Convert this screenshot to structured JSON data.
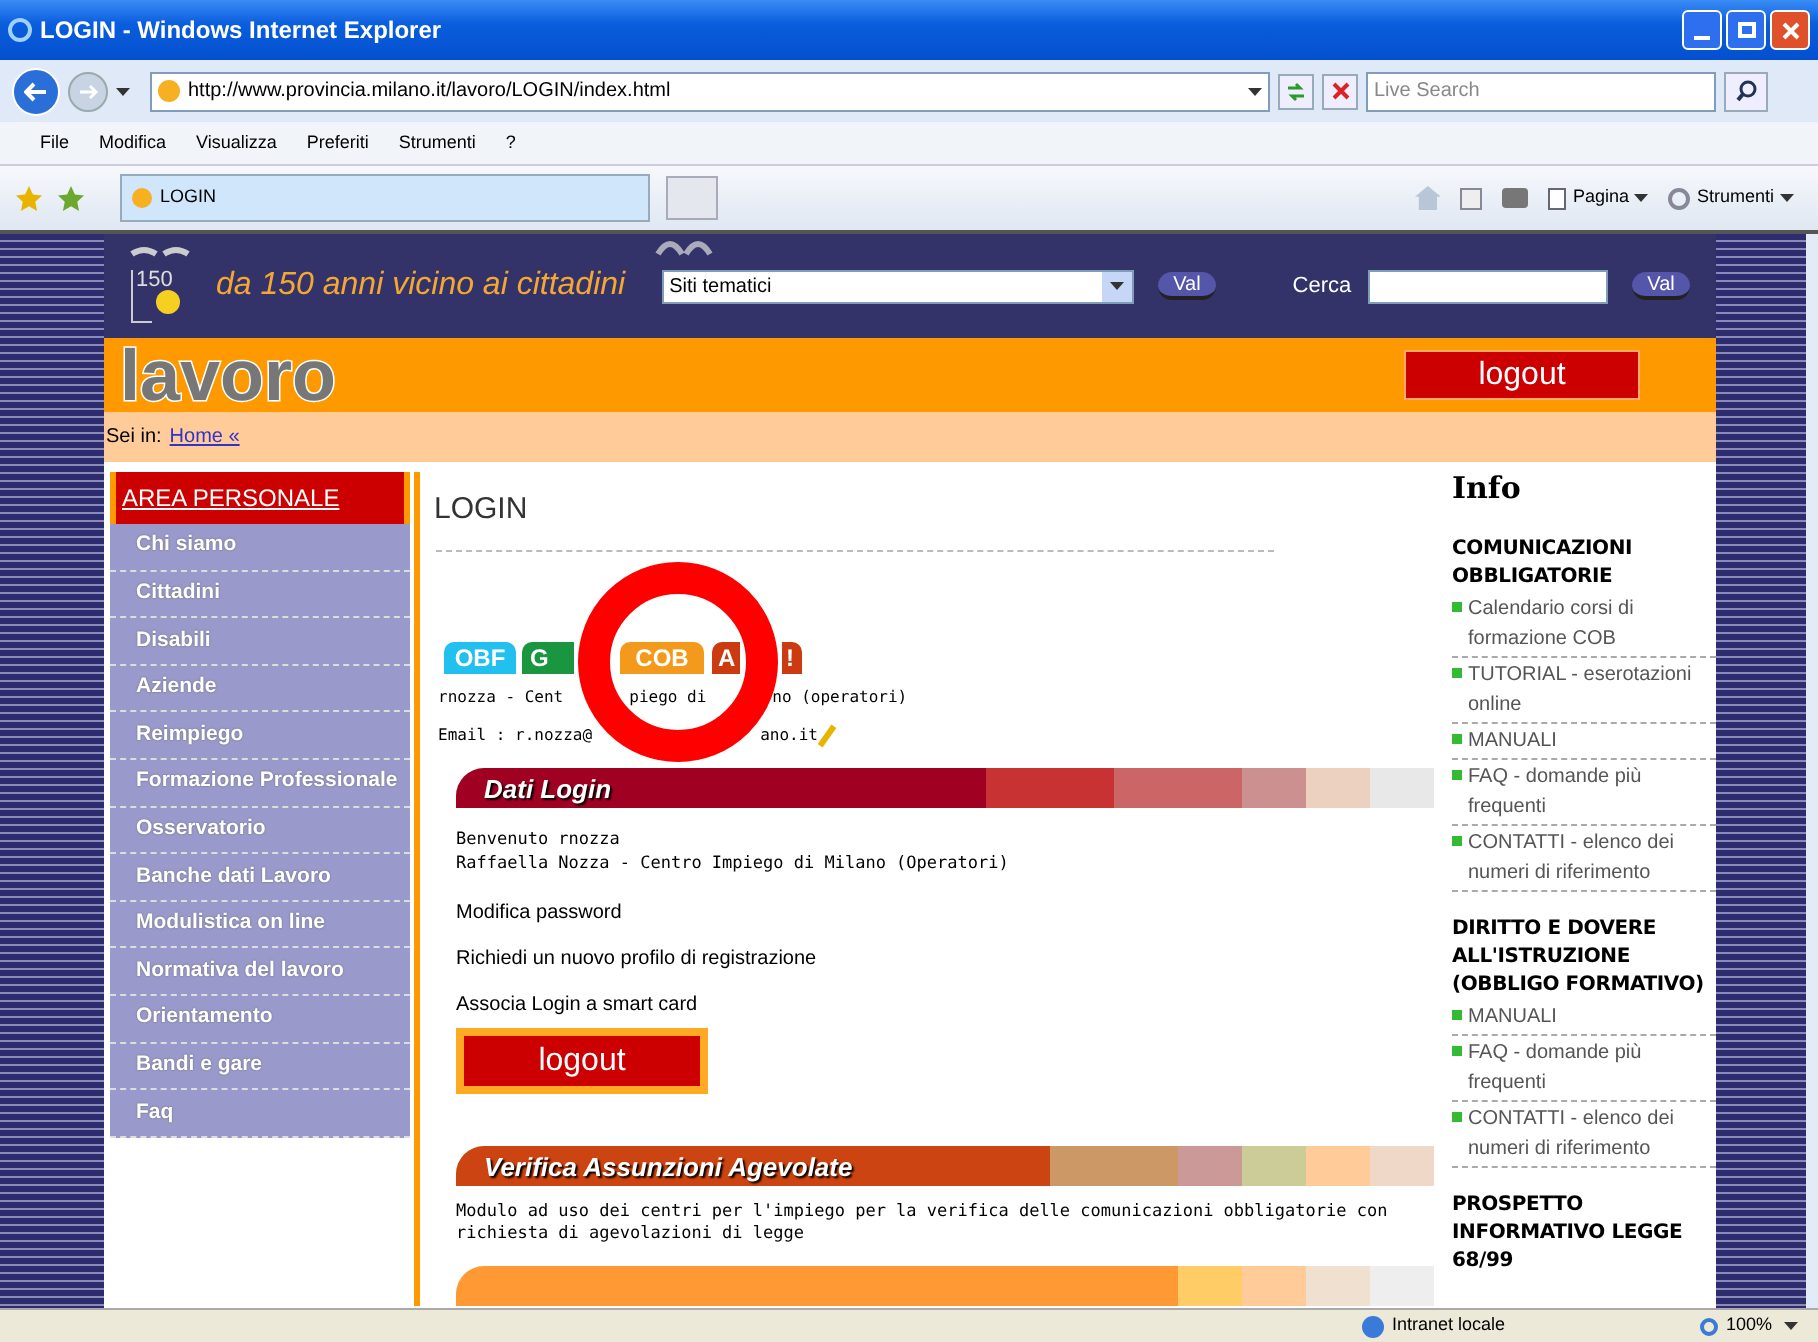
{
  "window": {
    "title": "LOGIN - Windows Internet Explorer"
  },
  "address_bar": {
    "url": "http://www.provincia.milano.it/lavoro/LOGIN/index.html",
    "search_placeholder": "Live Search"
  },
  "menu": [
    "File",
    "Modifica",
    "Visualizza",
    "Preferiti",
    "Strumenti",
    "?"
  ],
  "tabs": [
    {
      "label": "LOGIN",
      "selected": true
    }
  ],
  "command_bar": [
    "Pagina",
    "Strumenti"
  ],
  "page": {
    "header": {
      "logo_text": "150",
      "slogan": "da 150 anni vicino ai cittadini",
      "select_value": "Siti tematici",
      "go_buttons": [
        "Val",
        "Val"
      ],
      "search_label": "Cerca"
    },
    "section_title": "lavoro",
    "logout": "logout",
    "breadcrumb": {
      "prefix": "Sei in:",
      "link": "Home «"
    },
    "sidebar": {
      "header": "AREA PERSONALE",
      "items": [
        "Chi siamo",
        "Cittadini",
        "Disabili",
        "Aziende",
        "Reimpiego",
        "Formazione Professionale",
        "Osservatorio",
        "Banche dati Lavoro",
        "Modulistica on line",
        "Normativa del lavoro",
        "Orientamento",
        "Bandi e gare",
        "Faq"
      ]
    },
    "main": {
      "title": "LOGIN",
      "service_tabs": [
        {
          "label": "OBF",
          "color": "#22c0ee"
        },
        {
          "label": "G",
          "color": "#1a9640"
        },
        {
          "label": "COB",
          "color": "#f39a1c"
        },
        {
          "label": "A",
          "color": "#cc3a12",
          "tail": "!"
        }
      ],
      "user_line": [
        "rnozza - Cent",
        "piego di",
        "no (operatori)"
      ],
      "email_line": [
        "Email : r.nozza@",
        "ano.it"
      ],
      "dati_login": {
        "title": "Dati Login",
        "welcome": "Benvenuto rnozza",
        "user": "Raffaella Nozza - Centro Impiego di Milano (Operatori)",
        "links": [
          "Modifica password",
          "Richiedi un nuovo profilo di registrazione",
          "Associa Login a smart card"
        ],
        "logout": "logout"
      },
      "verifica": {
        "title": "Verifica Assunzioni Agevolate",
        "text": "Modulo ad uso dei centri per l'impiego per la verifica delle comunicazioni obbligatorie con richiesta di agevolazioni di legge"
      }
    },
    "info": {
      "title": "Info",
      "sections": [
        {
          "title": "COMUNICAZIONI OBBLIGATORIE",
          "links": [
            "Calendario corsi di formazione COB",
            "TUTORIAL - eserotazioni online",
            "MANUALI",
            "FAQ - domande più frequenti",
            "CONTATTI - elenco dei numeri di riferimento"
          ]
        },
        {
          "title": "DIRITTO E DOVERE ALL'ISTRUZIONE (OBBLIGO FORMATIVO)",
          "links": [
            "MANUALI",
            "FAQ - domande più frequenti",
            "CONTATTI - elenco dei numeri di riferimento"
          ]
        },
        {
          "title": "PROSPETTO INFORMATIVO LEGGE 68/99"
        }
      ]
    }
  },
  "status_bar": {
    "zone": "Intranet locale",
    "zoom": "100%"
  }
}
